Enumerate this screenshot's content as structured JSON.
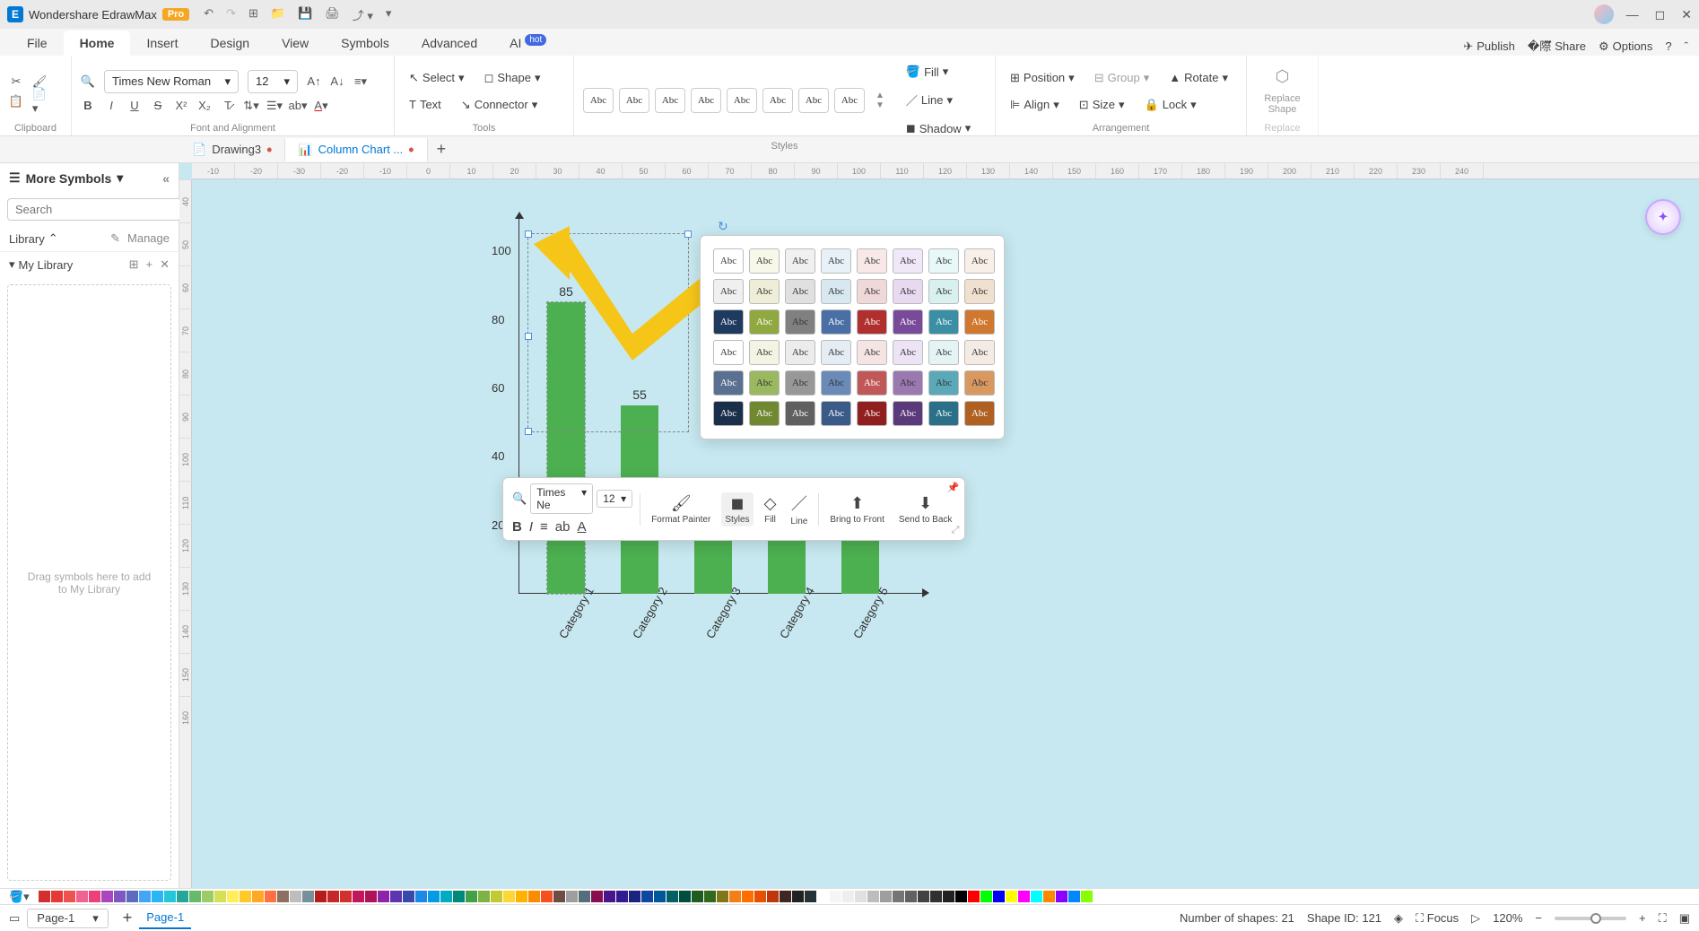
{
  "app": {
    "name": "Wondershare EdrawMax",
    "badge": "Pro"
  },
  "menubar": {
    "tabs": [
      "File",
      "Home",
      "Insert",
      "Design",
      "View",
      "Symbols",
      "Advanced",
      "AI"
    ],
    "active": "Home",
    "ai_badge": "hot",
    "right": {
      "publish": "Publish",
      "share": "Share",
      "options": "Options"
    }
  },
  "ribbon": {
    "font_family": "Times New Roman",
    "font_size": "12",
    "groups": {
      "clipboard": "Clipboard",
      "font": "Font and Alignment",
      "tools": "Tools",
      "styles": "Styles",
      "arrangement": "Arrangement",
      "replace": "Replace"
    },
    "tools": {
      "select": "Select",
      "shape": "Shape",
      "text": "Text",
      "connector": "Connector"
    },
    "style_label": "Abc",
    "fill": "Fill",
    "line": "Line",
    "shadow": "Shadow",
    "position": "Position",
    "group": "Group",
    "rotate": "Rotate",
    "align": "Align",
    "size": "Size",
    "lock": "Lock",
    "replace_shape": "Replace Shape"
  },
  "doctabs": {
    "tabs": [
      {
        "name": "Drawing3",
        "dirty": true,
        "active": false
      },
      {
        "name": "Column Chart ...",
        "dirty": true,
        "active": true
      }
    ]
  },
  "sidebar": {
    "title": "More Symbols",
    "search_placeholder": "Search",
    "search_btn": "Search",
    "library": "Library",
    "manage": "Manage",
    "my_library": "My Library",
    "drop_hint": "Drag symbols here to add to My Library"
  },
  "ruler_h": [
    "-10",
    "-20",
    "-30",
    "-20",
    "-10",
    "0",
    "10",
    "20",
    "30",
    "40",
    "50",
    "60",
    "70",
    "80",
    "90",
    "100",
    "110",
    "120",
    "130",
    "140",
    "150",
    "160",
    "170",
    "180",
    "190",
    "200",
    "210",
    "220",
    "230",
    "240"
  ],
  "ruler_v": [
    "40",
    "50",
    "60",
    "70",
    "80",
    "90",
    "100",
    "110",
    "120",
    "130",
    "140",
    "150",
    "160"
  ],
  "chart_data": {
    "type": "bar",
    "categories": [
      "Category 1",
      "Category 2",
      "Category 3",
      "Category 4",
      "Category 5"
    ],
    "values": [
      85,
      55,
      32,
      32,
      32
    ],
    "y_ticks": [
      20,
      40,
      60,
      80,
      100
    ],
    "ylim": [
      0,
      110
    ],
    "selected_bar": 0,
    "bar_color": "#4caf50"
  },
  "mini_toolbar": {
    "font": "Times Ne",
    "size": "12",
    "format_painter": "Format Painter",
    "styles": "Styles",
    "fill": "Fill",
    "line": "Line",
    "bring_front": "Bring to Front",
    "send_back": "Send to Back"
  },
  "style_popup": {
    "label": "Abc",
    "rows": [
      [
        "#ffffff",
        "#f8f8e8",
        "#f0f0f0",
        "#e8f0f8",
        "#f8e8e8",
        "#f0e8f8",
        "#e8f8f8",
        "#f8f0e8"
      ],
      [
        "#f0f0f0",
        "#eeeed8",
        "#e0e0e0",
        "#d8e8f0",
        "#f0d8d8",
        "#e8d8f0",
        "#d8f0f0",
        "#f0e0d0"
      ],
      [
        "#1e3a5f",
        "#8fa83f",
        "#808080",
        "#4a6fa5",
        "#b03030",
        "#7a4a9a",
        "#3a8fa5",
        "#d07830"
      ],
      [
        "#ffffff",
        "#f4f4e4",
        "#ececec",
        "#e4ecf4",
        "#f4e4e4",
        "#ece4f4",
        "#e4f4f4",
        "#f4ece4"
      ],
      [
        "#5a7090",
        "#9ab860",
        "#989898",
        "#6a8ab8",
        "#c05858",
        "#9a78b0",
        "#5aa8b8",
        "#d89860"
      ],
      [
        "#1a2f4a",
        "#708830",
        "#606060",
        "#3a5a88",
        "#902020",
        "#5a3a7a",
        "#2a7088",
        "#b06020"
      ]
    ]
  },
  "colorbar": [
    "#d32f2f",
    "#e53935",
    "#ef5350",
    "#f06292",
    "#ec407a",
    "#ab47bc",
    "#7e57c2",
    "#5c6bc0",
    "#42a5f5",
    "#29b6f6",
    "#26c6da",
    "#26a69a",
    "#66bb6a",
    "#9ccc65",
    "#d4e157",
    "#ffee58",
    "#ffca28",
    "#ffa726",
    "#ff7043",
    "#8d6e63",
    "#bdbdbd",
    "#78909c",
    "#b71c1c",
    "#c62828",
    "#d32f2f",
    "#c2185b",
    "#ad1457",
    "#8e24aa",
    "#5e35b1",
    "#3949ab",
    "#1e88e5",
    "#039be5",
    "#00acc1",
    "#00897b",
    "#43a047",
    "#7cb342",
    "#c0ca33",
    "#fdd835",
    "#ffb300",
    "#fb8c00",
    "#f4511e",
    "#6d4c41",
    "#9e9e9e",
    "#546e7a",
    "#880e4f",
    "#4a148c",
    "#311b92",
    "#1a237e",
    "#0d47a1",
    "#01579b",
    "#006064",
    "#004d40",
    "#1b5e20",
    "#33691e",
    "#827717",
    "#f57f17",
    "#ff6f00",
    "#e65100",
    "#bf360c",
    "#3e2723",
    "#212121",
    "#263238",
    "#ffffff",
    "#f5f5f5",
    "#eeeeee",
    "#e0e0e0",
    "#bdbdbd",
    "#9e9e9e",
    "#757575",
    "#616161",
    "#424242",
    "#303030",
    "#212121",
    "#000000",
    "#ff0000",
    "#00ff00",
    "#0000ff",
    "#ffff00",
    "#ff00ff",
    "#00ffff",
    "#ff8800",
    "#8800ff",
    "#0088ff",
    "#88ff00"
  ],
  "statusbar": {
    "page_select": "Page-1",
    "page_tab": "Page-1",
    "num_shapes": "Number of shapes: 21",
    "shape_id": "Shape ID: 121",
    "focus": "Focus",
    "zoom": "120%"
  }
}
